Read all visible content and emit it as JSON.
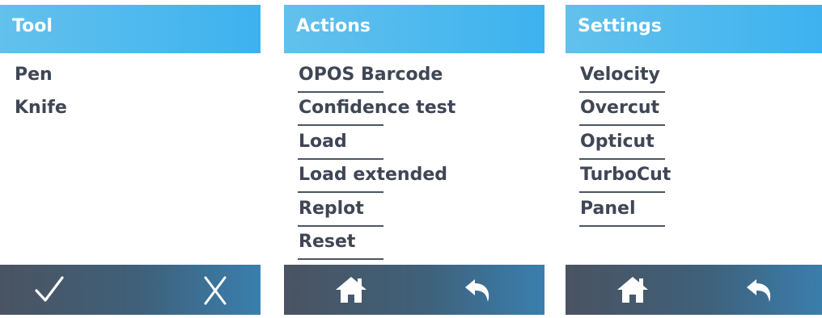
{
  "tool": {
    "title": "Tool",
    "items": [
      "Pen",
      "Knife"
    ],
    "footer": {
      "left_icon": "check-icon",
      "right_icon": "x-icon"
    }
  },
  "actions": {
    "title": "Actions",
    "items": [
      "OPOS Barcode",
      "Confidence test",
      "Load",
      "Load extended",
      "Replot",
      "Reset"
    ],
    "footer": {
      "left_icon": "home-icon",
      "right_icon": "back-arrow-icon"
    }
  },
  "settings": {
    "title": "Settings",
    "items": [
      "Velocity",
      "Overcut",
      "Opticut",
      "TurboCut",
      "Panel"
    ],
    "footer": {
      "left_icon": "home-icon",
      "right_icon": "back-arrow-icon"
    }
  },
  "colors": {
    "header_bg": "#3db2ef",
    "footer_bg": "#4a5361",
    "text": "#3f4654",
    "icon": "#ffffff"
  }
}
